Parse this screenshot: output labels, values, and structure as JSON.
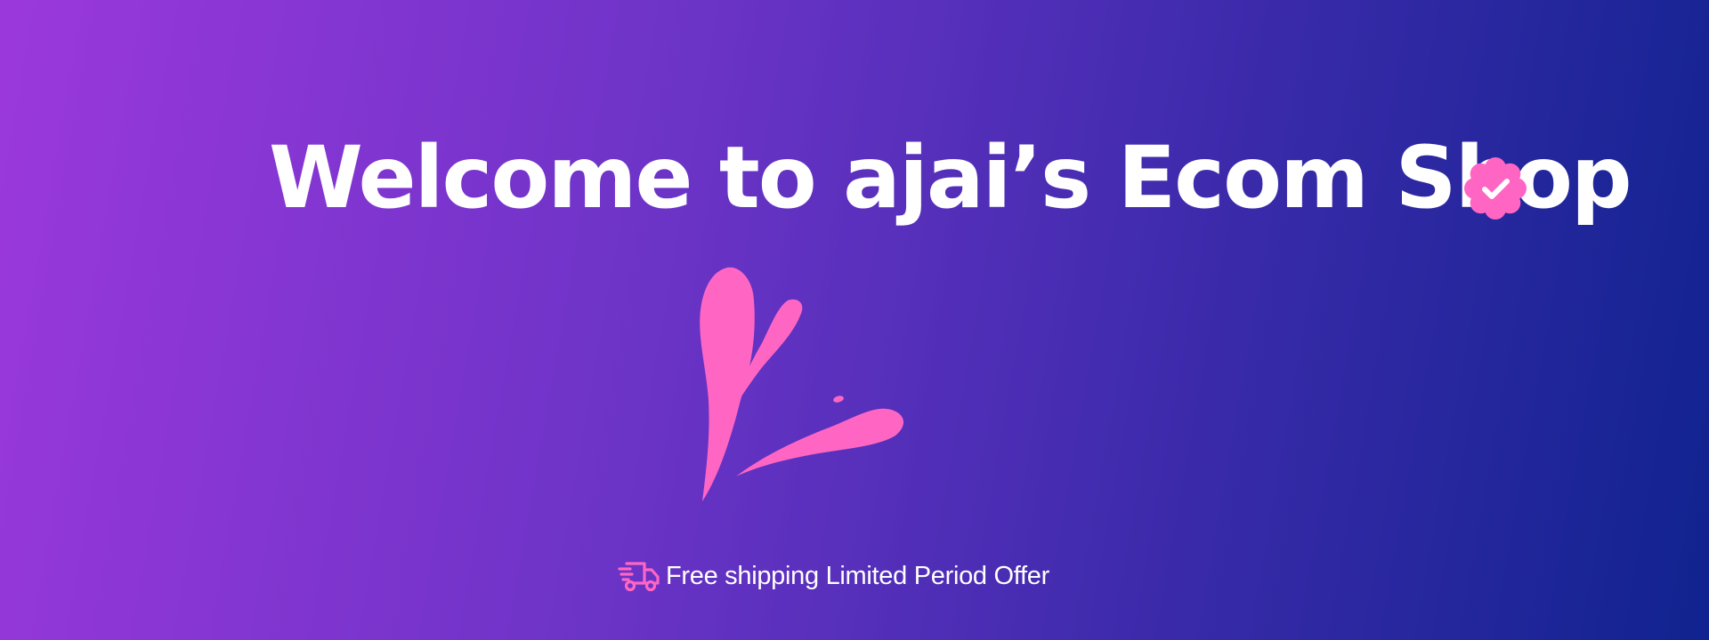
{
  "banner": {
    "headline": "Welcome to ajai’s Ecom Shop",
    "offer_text": "Free shipping Limited Period Offer",
    "icons": {
      "verified": "verified-badge-icon",
      "splash": "splash-logo-icon",
      "shipping": "delivery-truck-icon"
    }
  },
  "colors": {
    "gradient_start": "#9b38dc",
    "gradient_end": "#10238f",
    "accent_pink": "#ff66c4",
    "text": "#ffffff"
  }
}
